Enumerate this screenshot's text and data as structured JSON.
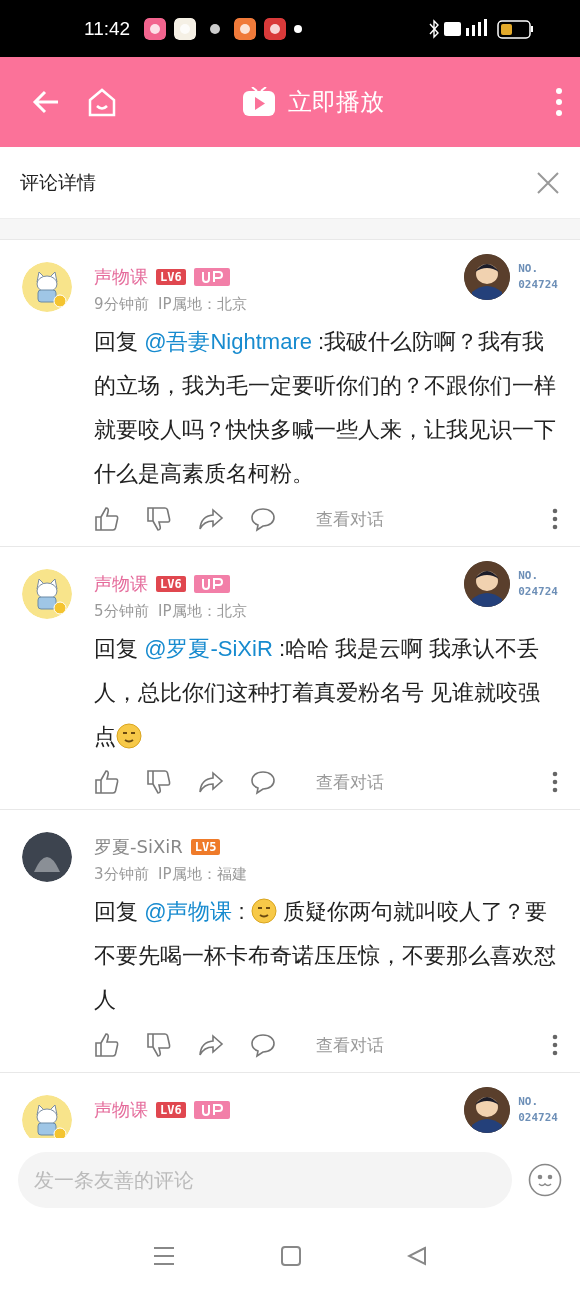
{
  "status_bar": {
    "time": "11:42"
  },
  "header": {
    "title": "立即播放"
  },
  "panel": {
    "title": "评论详情"
  },
  "comments": [
    {
      "kind": "cat",
      "user": "声物课",
      "level": "LV6",
      "up": true,
      "fan_badge": {
        "label": "NO.",
        "number": "024724"
      },
      "meta": "9分钟前  IP属地：北京",
      "body": [
        {
          "kind": "text",
          "text": "回复 "
        },
        {
          "kind": "mention",
          "text": "@吾妻Nightmare"
        },
        {
          "kind": "text",
          "text": " :我破什么防啊？我有我的立场，我为毛一定要听你们的？不跟你们一样就要咬人吗？快快多喊一些人来，让我见识一下什么是高素质名柯粉。"
        }
      ],
      "action": "查看对话"
    },
    {
      "kind": "cat",
      "user": "声物课",
      "level": "LV6",
      "up": true,
      "fan_badge": {
        "label": "NO.",
        "number": "024724"
      },
      "meta": "5分钟前  IP属地：北京",
      "body": [
        {
          "kind": "text",
          "text": "回复 "
        },
        {
          "kind": "mention",
          "text": "@罗夏-SiXiR"
        },
        {
          "kind": "text",
          "text": " :哈哈 我是云啊 我承认不丢人，总比你们这种打着真爱粉名号 见谁就咬强点"
        },
        {
          "kind": "emoji"
        }
      ],
      "action": "查看对话"
    },
    {
      "kind": "photo",
      "user": "罗夏-SiXiR",
      "level": "LV5",
      "up": false,
      "meta": "3分钟前  IP属地：福建",
      "body": [
        {
          "kind": "text",
          "text": "回复 "
        },
        {
          "kind": "mention",
          "text": "@声物课"
        },
        {
          "kind": "text",
          "text": " : "
        },
        {
          "kind": "emoji"
        },
        {
          "kind": "text",
          "text": " 质疑你两句就叫咬人了？要不要先喝一杯卡布奇诺压压惊，不要那么喜欢怼人"
        }
      ],
      "action": "查看对话"
    },
    {
      "kind": "cat",
      "user": "声物课",
      "level": "LV6",
      "up": true,
      "fan_badge": {
        "label": "NO.",
        "number": "024724"
      }
    }
  ],
  "composer": {
    "placeholder": "发一条友善的评论"
  }
}
